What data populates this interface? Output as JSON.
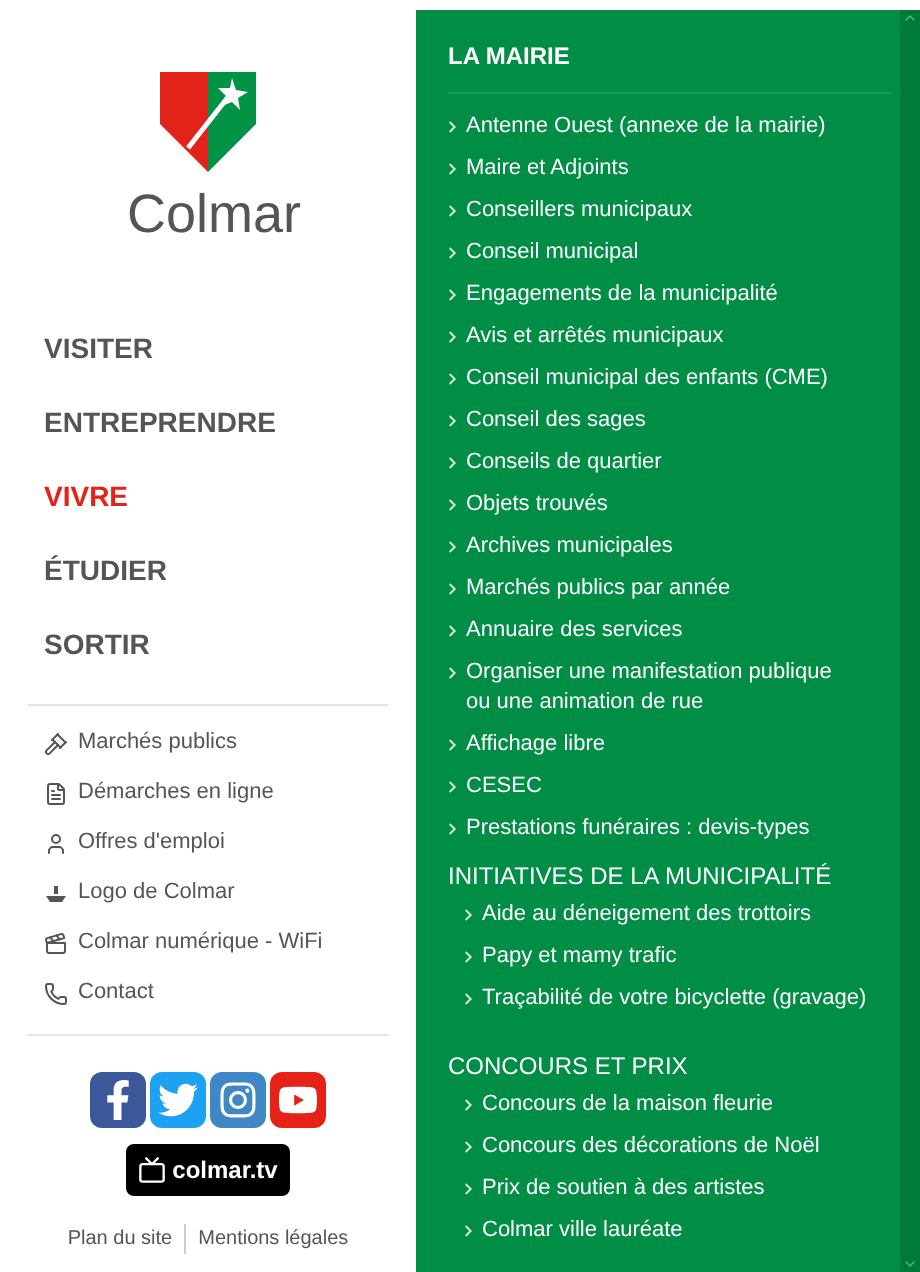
{
  "logo": {
    "text": "Colmar"
  },
  "main_nav": [
    {
      "label": "VISITER",
      "selected": false
    },
    {
      "label": "ENTREPRENDRE",
      "selected": false
    },
    {
      "label": "VIVRE",
      "selected": true
    },
    {
      "label": "ÉTUDIER",
      "selected": false
    },
    {
      "label": "SORTIR",
      "selected": false
    }
  ],
  "quick_links": [
    {
      "kind": "gavel",
      "label": "Marchés publics"
    },
    {
      "kind": "document",
      "label": "Démarches en ligne"
    },
    {
      "kind": "person",
      "label": "Offres d'emploi"
    },
    {
      "kind": "logo",
      "label": "Logo de Colmar"
    },
    {
      "kind": "clapper",
      "label": "Colmar numérique - WiFi"
    },
    {
      "kind": "phone",
      "label": "Contact"
    }
  ],
  "social": [
    {
      "kind": "facebook"
    },
    {
      "kind": "twitter"
    },
    {
      "kind": "instagram"
    },
    {
      "kind": "youtube"
    }
  ],
  "tv_badge": "colmar.tv",
  "footer_links": [
    "Plan du site",
    "Mentions légales"
  ],
  "menu_sections": [
    {
      "title": "LA MAIRIE",
      "kind": "main",
      "items": [
        "Antenne Ouest (annexe de la mairie)",
        "Maire et Adjoints",
        "Conseillers municipaux",
        "Conseil municipal",
        "Engagements de la municipalité",
        "Avis et arrêtés municipaux",
        "Conseil municipal des enfants (CME)",
        "Conseil des sages",
        "Conseils de quartier",
        "Objets trouvés",
        "Archives municipales",
        "Marchés publics par année",
        "Annuaire des services",
        "Organiser une manifestation publique ou une animation de rue",
        "Affichage libre",
        "CESEC",
        "Prestations funéraires : devis-types"
      ]
    },
    {
      "title": "INITIATIVES DE LA MUNICIPALITÉ",
      "kind": "sub",
      "items": [
        "Aide au déneigement des trottoirs",
        "Papy et mamy trafic",
        "Traçabilité de votre bicyclette (gravage)"
      ]
    },
    {
      "title": "CONCOURS ET PRIX",
      "kind": "sub",
      "items": [
        "Concours de la maison fleurie",
        "Concours des décorations de Noël",
        "Prix de soutien à des artistes",
        "Colmar ville lauréate"
      ]
    }
  ]
}
